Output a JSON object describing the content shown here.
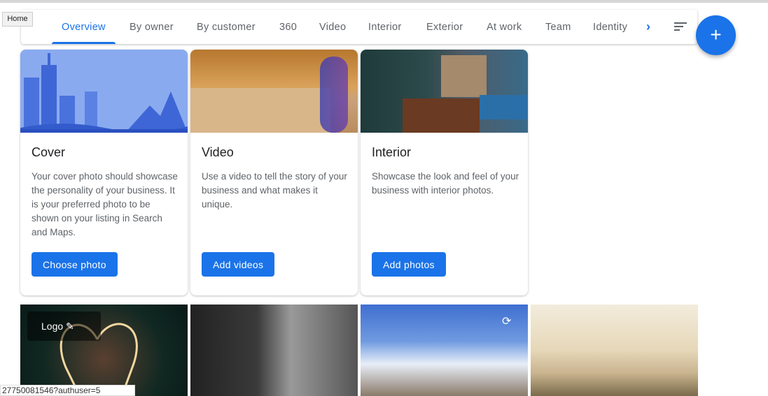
{
  "tooltip": "Home",
  "tabs": [
    "Overview",
    "By owner",
    "By customer",
    "360",
    "Video",
    "Interior",
    "Exterior",
    "At work",
    "Team",
    "Identity"
  ],
  "active_tab": "Overview",
  "cards": [
    {
      "title": "Cover",
      "description": "Your cover photo should showcase the personality of your business. It is your preferred photo to be shown on your listing in Search and Maps.",
      "button": "Choose photo"
    },
    {
      "title": "Video",
      "description": "Use a video to tell the story of your business and what makes it unique.",
      "button": "Add videos"
    },
    {
      "title": "Interior",
      "description": "Showcase the look and feel of your business with interior photos.",
      "button": "Add photos"
    }
  ],
  "photos": {
    "logo_label": "Logo"
  },
  "status_url": "27750081546?authuser=5",
  "colors": {
    "accent": "#1a73e8"
  }
}
